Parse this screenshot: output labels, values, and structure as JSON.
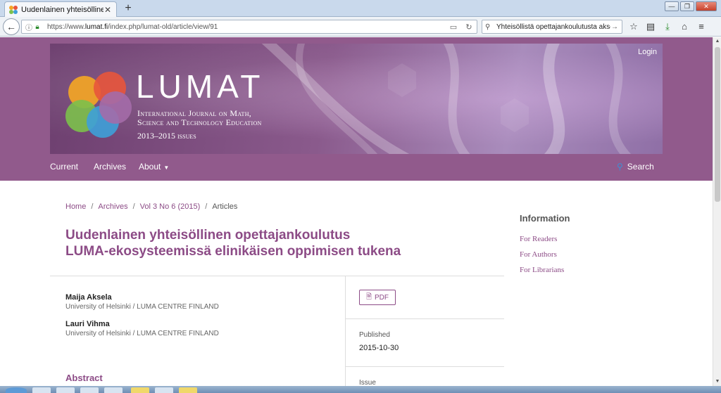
{
  "browser": {
    "tab_title": "Uudenlainen yhteisöllinen ...",
    "tab_close": "✕",
    "new_tab": "+",
    "url_prefix": "https://www.",
    "url_domain": "lumat.fi",
    "url_rest": "/index.php/lumat-old/article/view/91",
    "search_text": "Yhteisöllistä opettajankoulutusta aksela",
    "window_buttons": [
      "—",
      "❐",
      "✕"
    ]
  },
  "banner": {
    "title": "LUMAT",
    "subtitle_line1": "International Journal on Math,",
    "subtitle_line2": "Science and Technology Education",
    "years": "2013–2015 issues",
    "login": "Login",
    "logo_colors": [
      "#f5a623",
      "#e8553b",
      "#7cc04b",
      "#3ea0d8",
      "#8c4b86"
    ]
  },
  "nav": {
    "current": "Current",
    "archives": "Archives",
    "about": "About",
    "search": "Search"
  },
  "breadcrumb": {
    "home": "Home",
    "archives": "Archives",
    "issue": "Vol 3 No 6 (2015)",
    "current": "Articles",
    "sep": "/"
  },
  "article": {
    "title_line1": "Uudenlainen yhteisöllinen opettajankoulutus",
    "title_line2": "LUMA-ekosysteemissä elinikäisen oppimisen tukena",
    "authors": [
      {
        "name": "Maija Aksela",
        "affiliation": "University of Helsinki / LUMA CENTRE FINLAND"
      },
      {
        "name": "Lauri Vihma",
        "affiliation": "University of Helsinki / LUMA CENTRE FINLAND"
      }
    ],
    "abstract_heading": "Abstract",
    "pdf_label": "PDF",
    "published_label": "Published",
    "published_date": "2015-10-30",
    "issue_label": "Issue"
  },
  "sidebar": {
    "heading": "Information",
    "links": [
      "For Readers",
      "For Authors",
      "For Librarians"
    ]
  },
  "colors": {
    "brand": "#915a8c",
    "link": "#8c4b86"
  }
}
